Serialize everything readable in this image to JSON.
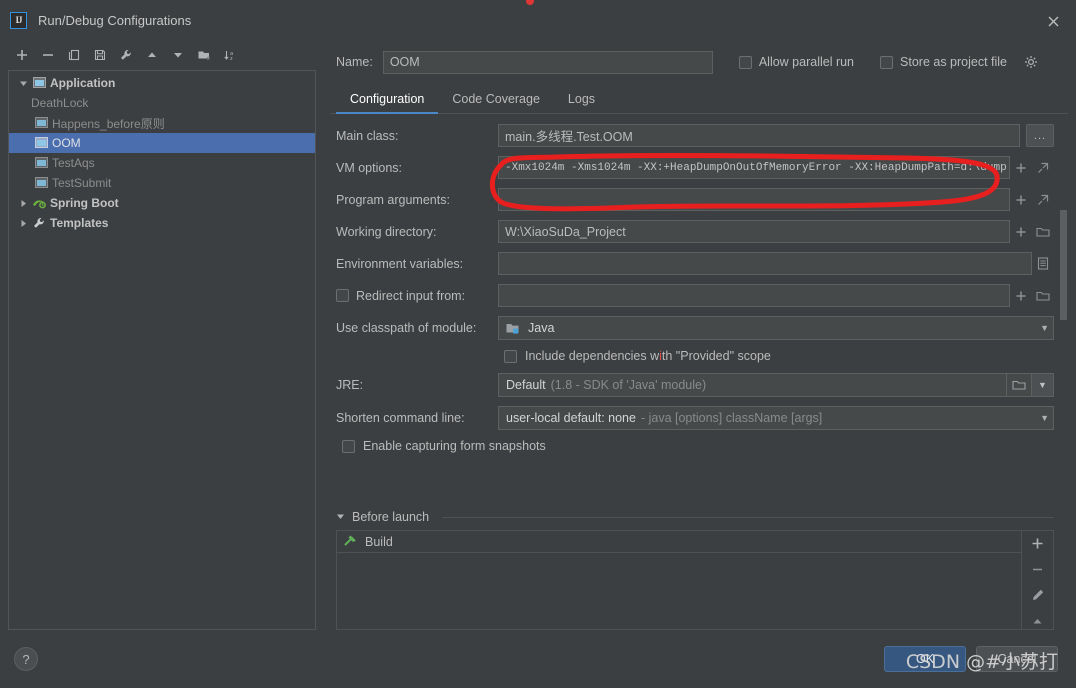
{
  "window": {
    "title": "Run/Debug Configurations",
    "app_icon_text": "IJ",
    "close_icon": "close-icon"
  },
  "tree_toolbar": [
    {
      "name": "add-configuration-button",
      "icon": "plus-icon"
    },
    {
      "name": "remove-configuration-button",
      "icon": "minus-icon"
    },
    {
      "name": "copy-configuration-button",
      "icon": "copy-icon"
    },
    {
      "name": "save-configuration-button",
      "icon": "save-icon"
    },
    {
      "name": "edit-templates-button",
      "icon": "wrench-icon"
    },
    {
      "name": "move-up-button",
      "icon": "arrow-up-icon"
    },
    {
      "name": "move-down-button",
      "icon": "arrow-down-icon"
    },
    {
      "name": "new-folder-button",
      "icon": "new-folder-icon"
    },
    {
      "name": "sort-configurations-button",
      "icon": "sort-az-icon"
    }
  ],
  "tree": {
    "items": [
      {
        "label": "Application",
        "level": 0,
        "expanded": true,
        "bold": true,
        "icon": "application-icon",
        "selected": false,
        "has_icon": true
      },
      {
        "label": "DeathLock",
        "level": 1,
        "expanded": null,
        "bold": false,
        "icon": "none",
        "selected": false,
        "has_icon": false
      },
      {
        "label": "Happens_before原则",
        "level": 1,
        "expanded": null,
        "bold": false,
        "icon": "application-icon",
        "selected": false,
        "has_icon": true
      },
      {
        "label": "OOM",
        "level": 1,
        "expanded": null,
        "bold": false,
        "icon": "application-icon",
        "selected": true,
        "has_icon": true
      },
      {
        "label": "TestAqs",
        "level": 1,
        "expanded": null,
        "bold": false,
        "icon": "application-icon",
        "selected": false,
        "has_icon": true
      },
      {
        "label": "TestSubmit",
        "level": 1,
        "expanded": null,
        "bold": false,
        "icon": "application-icon",
        "selected": false,
        "has_icon": true
      },
      {
        "label": "Spring Boot",
        "level": 0,
        "expanded": false,
        "bold": true,
        "icon": "spring-boot-icon",
        "selected": false,
        "has_icon": true
      },
      {
        "label": "Templates",
        "level": 0,
        "expanded": false,
        "bold": true,
        "icon": "wrench-icon",
        "selected": false,
        "has_icon": true
      }
    ]
  },
  "header": {
    "name_label": "Name:",
    "name_value": "OOM",
    "allow_parallel_run_label": "Allow parallel run",
    "allow_parallel_run_checked": false,
    "store_as_project_file_label": "Store as project file",
    "store_as_project_file_checked": false,
    "settings_icon": "gear-icon"
  },
  "tabs": [
    {
      "label": "Configuration",
      "active": true
    },
    {
      "label": "Code Coverage",
      "active": false
    },
    {
      "label": "Logs",
      "active": false
    }
  ],
  "form": {
    "main_class": {
      "label": "Main class:",
      "value": "main.多线程.Test.OOM",
      "browse_label": "..."
    },
    "vm_options": {
      "label": "VM options:",
      "value": "-Xmx1024m -Xms1024m -XX:+HeapDumpOnOutOfMemoryError -XX:HeapDumpPath=d:\\dump",
      "insert_macro_icon": "plus-icon",
      "expand_icon": "expand-icon"
    },
    "program_arguments": {
      "label": "Program arguments:",
      "value": "",
      "insert_macro_icon": "plus-icon",
      "expand_icon": "expand-icon"
    },
    "working_directory": {
      "label": "Working directory:",
      "value": "W:\\XiaoSuDa_Project",
      "insert_macro_icon": "plus-icon",
      "browse_icon": "folder-icon"
    },
    "environment_variables": {
      "label": "Environment variables:",
      "value": "",
      "browse_icon": "list-icon"
    },
    "redirect_input": {
      "label": "Redirect input from:",
      "checked": false,
      "value": "",
      "insert_macro_icon": "plus-icon",
      "browse_icon": "folder-icon"
    },
    "use_classpath_of_module": {
      "label": "Use classpath of module:",
      "value": "Java",
      "module_icon": "module-folder-icon",
      "dropdown_icon": "chevron-down-icon"
    },
    "include_provided": {
      "label_before": "Include dependencies w",
      "label_typo": "i",
      "label_after": "th \"Provided\" scope",
      "full_label": "Include dependencies with \"Provided\" scope",
      "checked": false
    },
    "jre": {
      "label": "JRE:",
      "value": "Default",
      "hint": "(1.8 - SDK of 'Java' module)",
      "browse_icon": "folder-icon",
      "dropdown_icon": "chevron-down-icon"
    },
    "shorten_command_line": {
      "label": "Shorten command line:",
      "value": "user-local default: none",
      "hint": "- java [options] className [args]",
      "dropdown_icon": "chevron-down-icon"
    },
    "enable_capturing": {
      "label": "Enable capturing form snapshots",
      "checked": false
    }
  },
  "before_launch": {
    "title": "Before launch",
    "expanded": true,
    "collapse_icon": "chevron-down-icon",
    "items": [
      {
        "label": "Build",
        "icon": "build-hammer-icon"
      }
    ],
    "side_buttons": [
      {
        "name": "add-task-button",
        "icon": "plus-icon"
      },
      {
        "name": "remove-task-button",
        "icon": "minus-icon"
      },
      {
        "name": "edit-task-button",
        "icon": "pencil-icon"
      },
      {
        "name": "move-task-up-button",
        "icon": "arrow-up-icon"
      }
    ]
  },
  "footer": {
    "help_label": "?",
    "ok_label": "OK",
    "cancel_label": "Cancel"
  },
  "watermark": {
    "text": "CSDN @#小苏打"
  },
  "colors": {
    "background": "#3c3f41",
    "field_background": "#45494a",
    "selection_blue": "#4b6eaf",
    "tab_accent": "#4a88c7",
    "primary_button": "#365880",
    "annotation_red": "#e81f1f",
    "text": "#bbbbbb"
  }
}
